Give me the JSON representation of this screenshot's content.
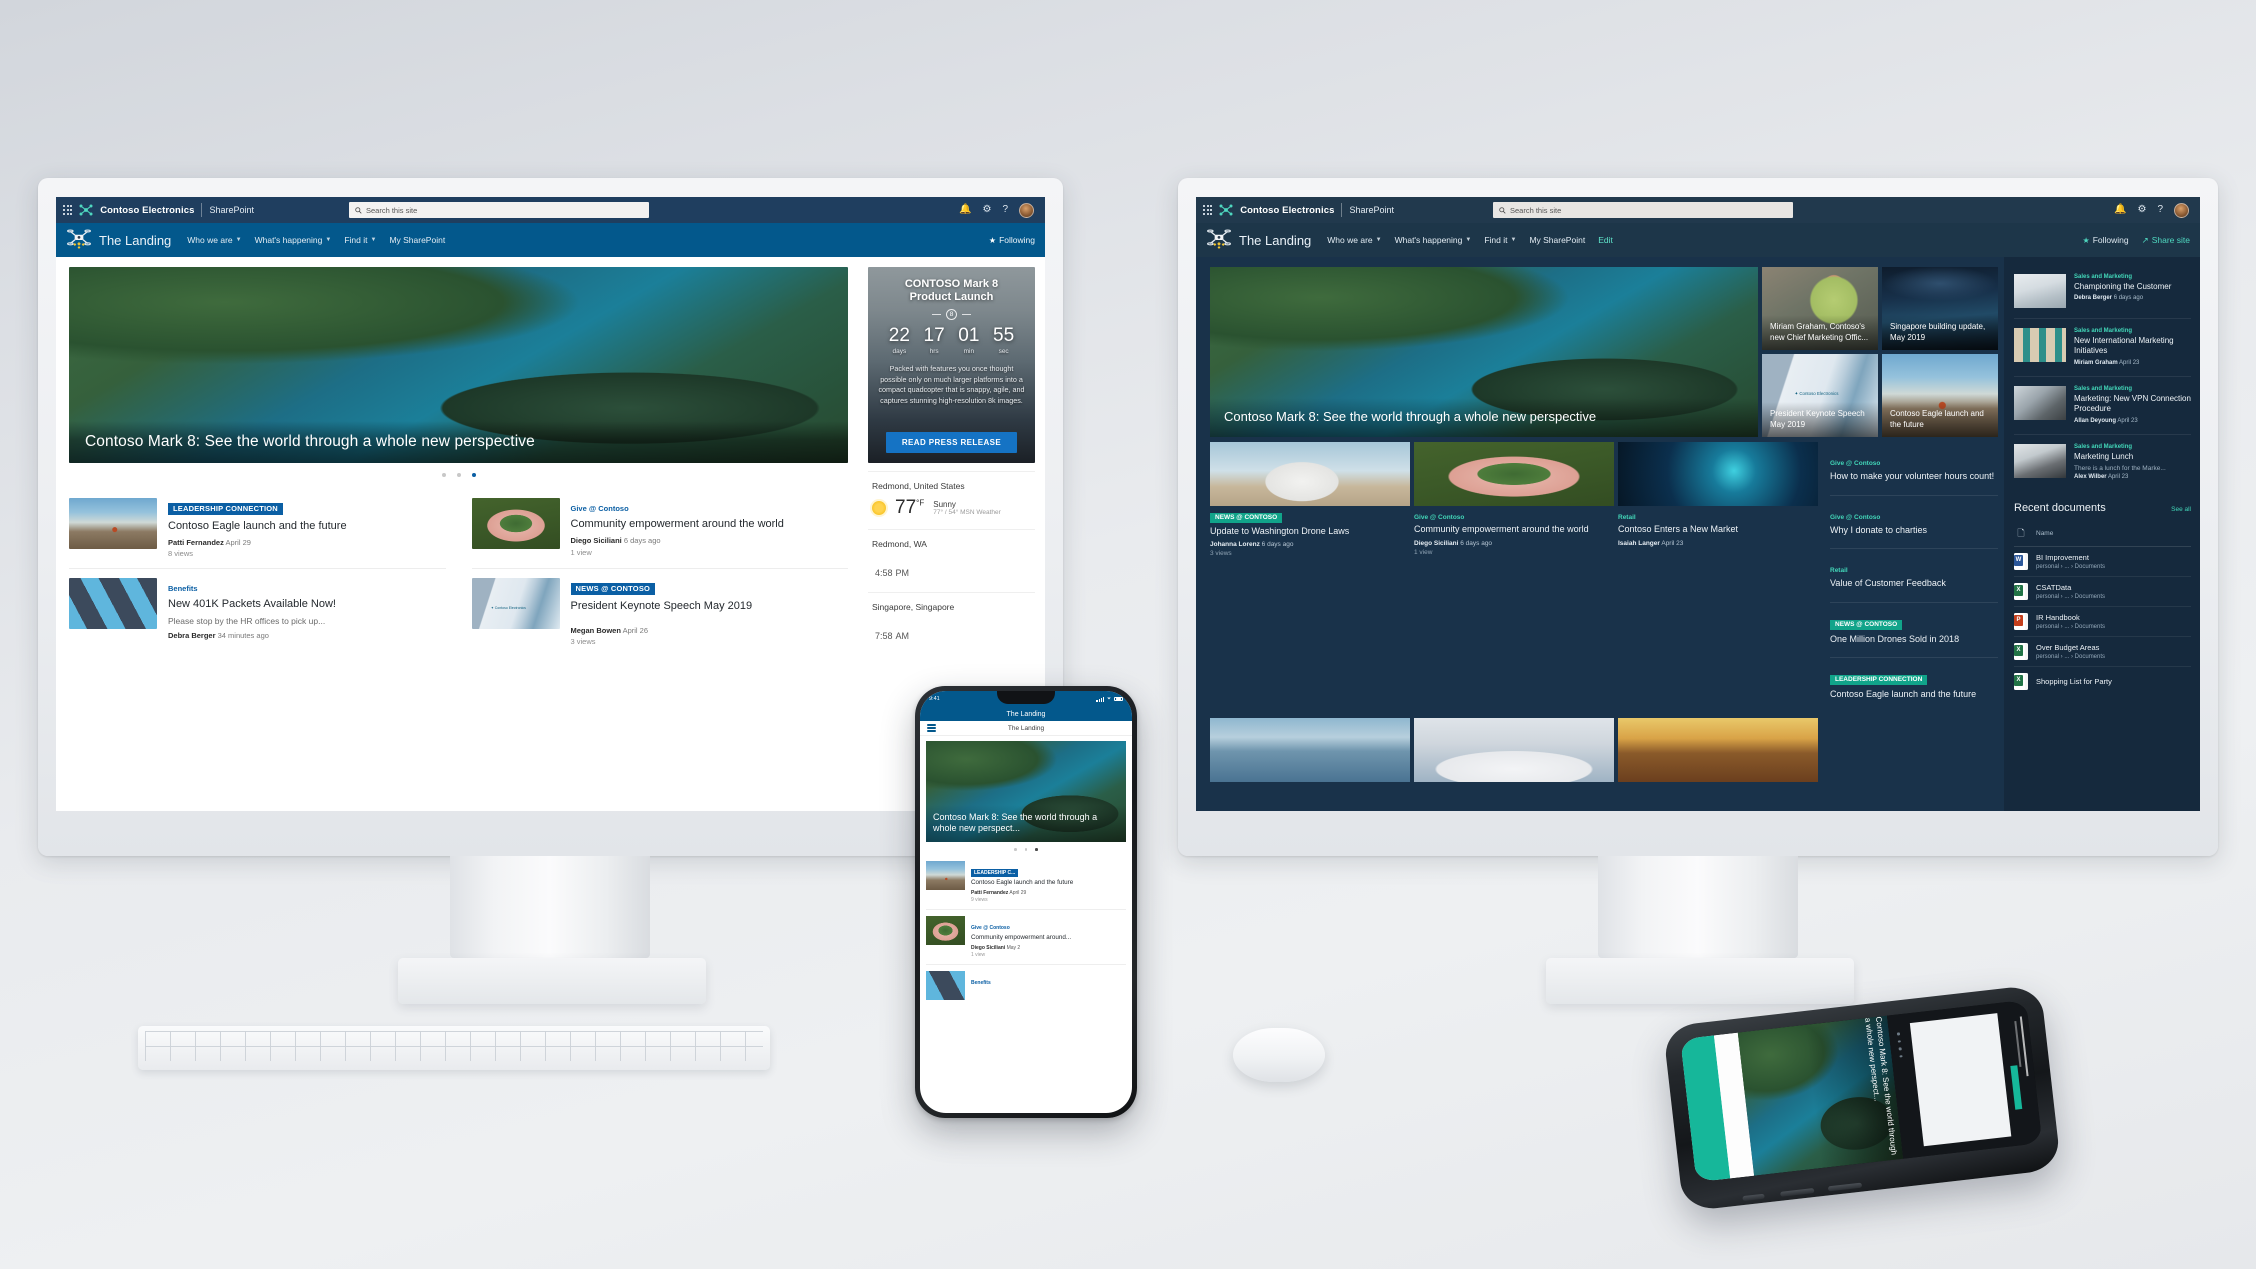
{
  "suite": {
    "app_title": "Contoso Electronics",
    "product": "SharePoint",
    "search_placeholder": "Search this site",
    "waffle_icon": "app-launcher-icon",
    "bell_icon": "notifications-icon",
    "gear_icon": "settings-icon",
    "help_icon": "help-icon",
    "avatar_icon": "user-avatar"
  },
  "site_nav": {
    "site_name": "The Landing",
    "links": [
      {
        "label": "Who we are",
        "has_chevron": true
      },
      {
        "label": "What's happening",
        "has_chevron": true
      },
      {
        "label": "Find it",
        "has_chevron": true
      },
      {
        "label": "My SharePoint",
        "has_chevron": false
      }
    ],
    "edit_label": "Edit",
    "following_label": "Following",
    "share_site_label": "Share site"
  },
  "left_monitor": {
    "hero": {
      "title": "Contoso Mark 8: See the world through a whole new perspective",
      "dots": 3,
      "active_dot": 3
    },
    "news": [
      {
        "category": "LEADERSHIP CONNECTION",
        "category_style": "badge",
        "title": "Contoso Eagle launch and the future",
        "snippet": "",
        "author": "Patti Fernandez",
        "when": "April 29",
        "views": "8 views",
        "thumb": "ph-hiker"
      },
      {
        "category": "Give @ Contoso",
        "category_style": "plain",
        "title": "Community empowerment around the world",
        "snippet": "",
        "author": "Diego Siciliani",
        "when": "6 days ago",
        "views": "1 view",
        "thumb": "ph-hands"
      },
      {
        "category": "Benefits",
        "category_style": "plain",
        "title": "New 401K Packets Available Now!",
        "snippet": "Please stop by the HR offices to pick up...",
        "author": "Debra Berger",
        "when": "34 minutes ago",
        "views": "",
        "thumb": "ph-cards"
      },
      {
        "category": "NEWS @ CONTOSO",
        "category_style": "badge",
        "title": "President Keynote Speech May 2019",
        "snippet": "",
        "author": "Megan Bowen",
        "when": "April 26",
        "views": "3 views",
        "thumb": "ph-building"
      }
    ],
    "countdown": {
      "title_line1": "CONTOSO Mark 8",
      "title_line2": "Product Launch",
      "badge": "8",
      "units": [
        {
          "value": "22",
          "label": "days"
        },
        {
          "value": "17",
          "label": "hrs"
        },
        {
          "value": "01",
          "label": "min"
        },
        {
          "value": "55",
          "label": "sec"
        }
      ],
      "description": "Packed with features you once thought possible only on much larger platforms into a compact quadcopter that is snappy, agile, and captures stunning high-resolution 8k images.",
      "button": "READ PRESS RELEASE"
    },
    "weather": {
      "location": "Redmond, United States",
      "temp": "77",
      "unit": "°F",
      "condition": "Sunny",
      "sub": "77° / 54°   MSN Weather",
      "icon": "sun-icon"
    },
    "clocks": [
      {
        "location": "Redmond, WA",
        "time": "4:58",
        "meridiem": "PM"
      },
      {
        "location": "Singapore, Singapore",
        "time": "7:58",
        "meridiem": "AM"
      }
    ]
  },
  "right_monitor": {
    "hero": {
      "title": "Contoso Mark 8: See the world through a whole new perspective"
    },
    "tiles": [
      {
        "title": "Miriam Graham, Contoso's new Chief Marketing Offic...",
        "thumb": "ph-woman"
      },
      {
        "title": "Singapore building update, May 2019",
        "thumb": "ph-city"
      },
      {
        "title": "President Keynote Speech May 2019",
        "thumb": "ph-building"
      },
      {
        "title": "Contoso Eagle launch and the future",
        "thumb": "ph-hiker"
      }
    ],
    "news_row1": [
      {
        "category": "NEWS @ CONTOSO",
        "category_style": "badge",
        "title": "Update to Washington Drone Laws",
        "author": "Johanna Lorenz",
        "when": "6 days ago",
        "views": "3 views",
        "thumb": "ph-drone-man"
      },
      {
        "category": "Give @ Contoso",
        "category_style": "plain",
        "title": "Community empowerment around the world",
        "author": "Diego Siciliani",
        "when": "6 days ago",
        "views": "1 view",
        "thumb": "ph-hands"
      },
      {
        "category": "Retail",
        "category_style": "plain",
        "title": "Contoso Enters a New Market",
        "author": "Isaiah Langer",
        "when": "April 23",
        "views": "",
        "thumb": "ph-network"
      }
    ],
    "news_row2": [
      {
        "thumb": "ph-drone-lake"
      },
      {
        "thumb": "ph-meeting"
      },
      {
        "thumb": "ph-field"
      }
    ],
    "links": [
      {
        "category": "Give @ Contoso",
        "category_style": "plain",
        "title": "How to make your volunteer hours count!"
      },
      {
        "category": "Give @ Contoso",
        "category_style": "plain",
        "title": "Why I donate to charties"
      },
      {
        "category": "Retail",
        "category_style": "plain",
        "title": "Value of Customer Feedback"
      },
      {
        "category": "NEWS @ CONTOSO",
        "category_style": "badge",
        "title": "One Million Drones Sold in 2018"
      },
      {
        "category": "LEADERSHIP CONNECTION",
        "category_style": "badge",
        "title": "Contoso Eagle launch and the future"
      }
    ],
    "sidebar_news": [
      {
        "category": "Sales and Marketing",
        "title": "Championing the Customer",
        "snippet": "",
        "author": "Debra Berger",
        "when": "6 days ago",
        "thumb": "ph-desk"
      },
      {
        "category": "Sales and Marketing",
        "title": "New International Marketing Initiatives",
        "snippet": "",
        "author": "Miriam Graham",
        "when": "April 23",
        "thumb": "ph-flags"
      },
      {
        "category": "Sales and Marketing",
        "title": "Marketing: New VPN Connection Procedure",
        "snippet": "",
        "author": "Allan Deyoung",
        "when": "April 23",
        "thumb": "ph-laptopman"
      },
      {
        "category": "Sales and Marketing",
        "title": "Marketing Lunch",
        "snippet": "There is a lunch for the Marke...",
        "author": "Alex Wilber",
        "when": "April 23",
        "thumb": "ph-woman2"
      }
    ],
    "recent_documents": {
      "heading": "Recent documents",
      "see_all": "See all",
      "column_header": "Name",
      "file_icon": "document-icon",
      "items": [
        {
          "name": "BI Improvement",
          "path": "personal  ›  ...  ›  Documents",
          "type": "w",
          "glyph": "W"
        },
        {
          "name": "CSATData",
          "path": "personal  ›  ...  ›  Documents",
          "type": "x",
          "glyph": "X"
        },
        {
          "name": "IR Handbook",
          "path": "personal  ›  ...  ›  Documents",
          "type": "p",
          "glyph": "P"
        },
        {
          "name": "Over Budget Areas",
          "path": "personal  ›  ...  ›  Documents",
          "type": "x",
          "glyph": "X"
        },
        {
          "name": "Shopping List for Party",
          "path": "",
          "type": "x",
          "glyph": "X"
        }
      ]
    }
  },
  "phone": {
    "status_time": "9:41",
    "app_title": "The Landing",
    "sub_title": "The Landing",
    "menu_icon": "hamburger-menu-icon",
    "hero_title": "Contoso Mark 8: See the world through a whole new perspect...",
    "cards": [
      {
        "category": "LEADERSHIP C...",
        "category_style": "badge",
        "title": "Contoso Eagle launch and the future",
        "author": "Patti Fernandez",
        "when": "April 29",
        "views": "9 views",
        "thumb": "ph-hiker"
      },
      {
        "category": "Give @ Contoso",
        "category_style": "plain",
        "title": "Community empowerment around...",
        "author": "Diego Siciliani",
        "when": "May 2",
        "views": "1 view",
        "thumb": "ph-hands"
      },
      {
        "category": "Benefits",
        "category_style": "plain",
        "title": "",
        "author": "",
        "when": "",
        "views": "",
        "thumb": "ph-cards"
      }
    ]
  },
  "colors": {
    "suite_blue": "#1f3e5f",
    "suite_dark": "#21394d",
    "nav_blue": "#03588c",
    "nav_dark": "#1d3649",
    "accent_blue": "#0b5fa4",
    "accent_teal": "#42d6b8",
    "teal_badge": "#11a48a",
    "dark_bg": "#19324a",
    "dark_side": "#15293d",
    "phone_teal": "#16b79a"
  }
}
